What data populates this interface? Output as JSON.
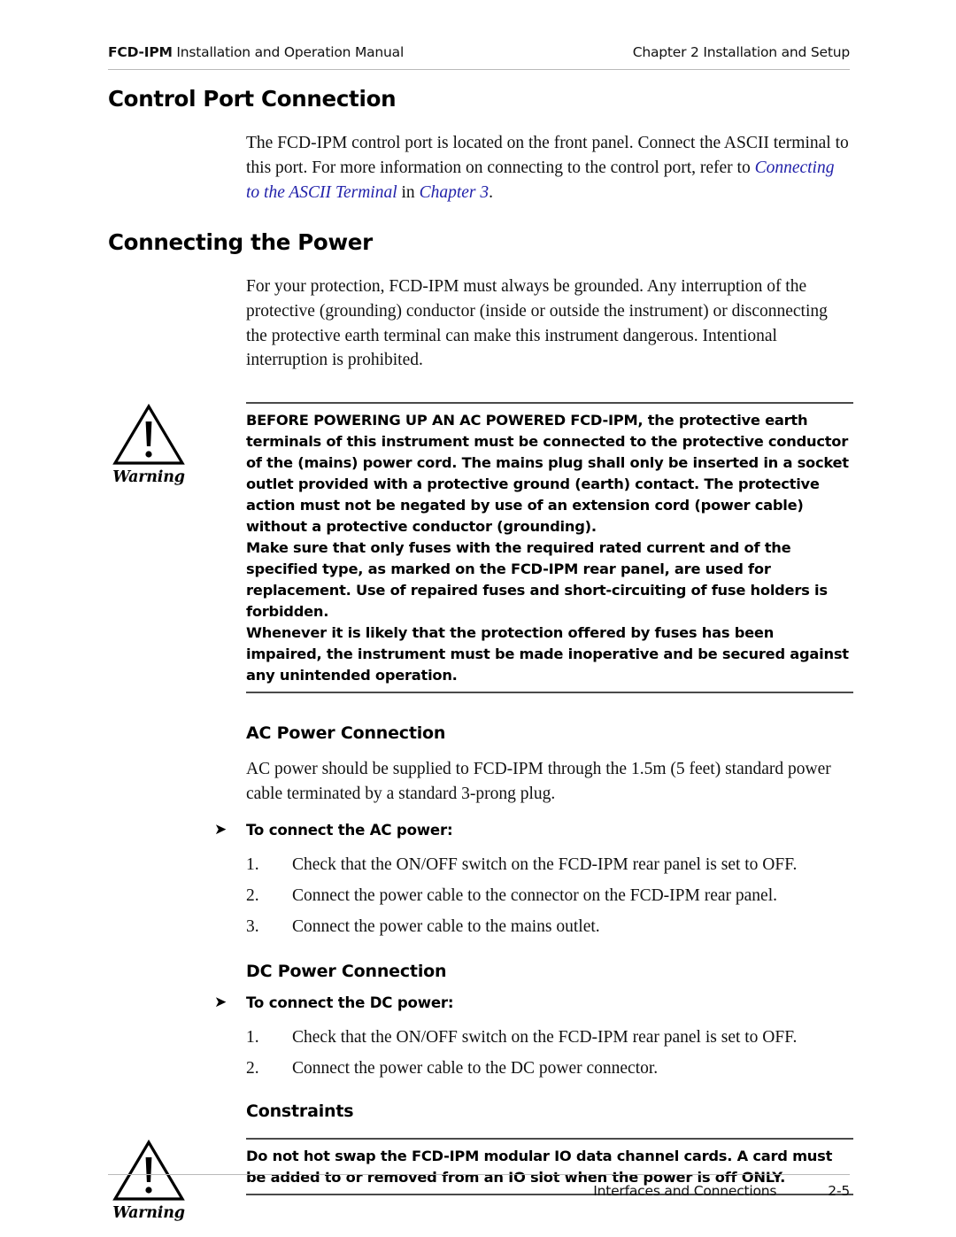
{
  "header": {
    "left_bold": "FCD-IPM",
    "left_rest": " Installation and Operation Manual",
    "right": "Chapter 2  Installation and Setup"
  },
  "sections": {
    "control_port": {
      "heading": "Control Port Connection",
      "para_part1": "The FCD-IPM control port is located on the front panel. Connect the ASCII terminal to this port. For more information on connecting to the control port, refer to ",
      "xref1": "Connecting to the ASCII Terminal",
      "para_part2": " in ",
      "xref2": "Chapter 3",
      "para_part3": "."
    },
    "connecting_power": {
      "heading": "Connecting the Power",
      "paragraph": "For your protection, FCD-IPM must always be grounded. Any interruption of the protective (grounding) conductor (inside or outside the instrument) or disconnecting the protective earth terminal can make this instrument dangerous. Intentional interruption is prohibited."
    },
    "warning_main": {
      "icon_label": "Warning",
      "paragraphs": [
        "BEFORE POWERING UP AN AC POWERED FCD-IPM, the protective earth terminals of this instrument must be connected to the protective conductor of the (mains) power cord. The mains plug shall only be inserted in a socket outlet provided with a protective ground (earth) contact. The protective action must not be negated by use of an extension cord (power cable) without a protective conductor (grounding).",
        "Make sure that only fuses with the required rated current and of the specified type, as marked on the FCD-IPM rear panel, are used for replacement. Use of repaired fuses and short-circuiting of fuse holders is forbidden.",
        "Whenever it is likely that the protection offered by fuses has been impaired, the instrument must be made inoperative and be secured against any unintended operation."
      ]
    },
    "ac_power": {
      "heading": "AC Power Connection",
      "paragraph": "AC power should be supplied to FCD-IPM through the 1.5m (5 feet) standard power cable terminated by a standard 3-prong plug.",
      "lead_in": "To connect the AC power:",
      "arrow_glyph": "➤",
      "steps": [
        {
          "num": "1.",
          "text": "Check that the ON/OFF switch on the FCD-IPM rear panel is set to OFF."
        },
        {
          "num": "2.",
          "text": "Connect the power cable to the connector on the FCD-IPM rear panel."
        },
        {
          "num": "3.",
          "text": "Connect the power cable to the mains outlet."
        }
      ]
    },
    "dc_power": {
      "heading": "DC Power Connection",
      "lead_in": "To connect the DC power:",
      "arrow_glyph": "➤",
      "steps": [
        {
          "num": "1.",
          "text": "Check that the ON/OFF switch on the FCD-IPM rear panel is set to OFF."
        },
        {
          "num": "2.",
          "text": "Connect the power cable to the DC power connector."
        }
      ]
    },
    "constraints": {
      "heading": "Constraints",
      "warning": {
        "icon_label": "Warning",
        "paragraphs": [
          "Do not hot swap the FCD-IPM modular IO data channel cards. A card must be added to or removed from an IO slot when the power is off ONLY."
        ]
      }
    }
  },
  "footer": {
    "title": "Interfaces and Connections",
    "page_number": "2-5"
  },
  "colors": {
    "xref_blue": "#2222aa",
    "rule_gray": "#b9b9b9",
    "warn_rule": "#4a4a4a",
    "text": "#000000"
  }
}
